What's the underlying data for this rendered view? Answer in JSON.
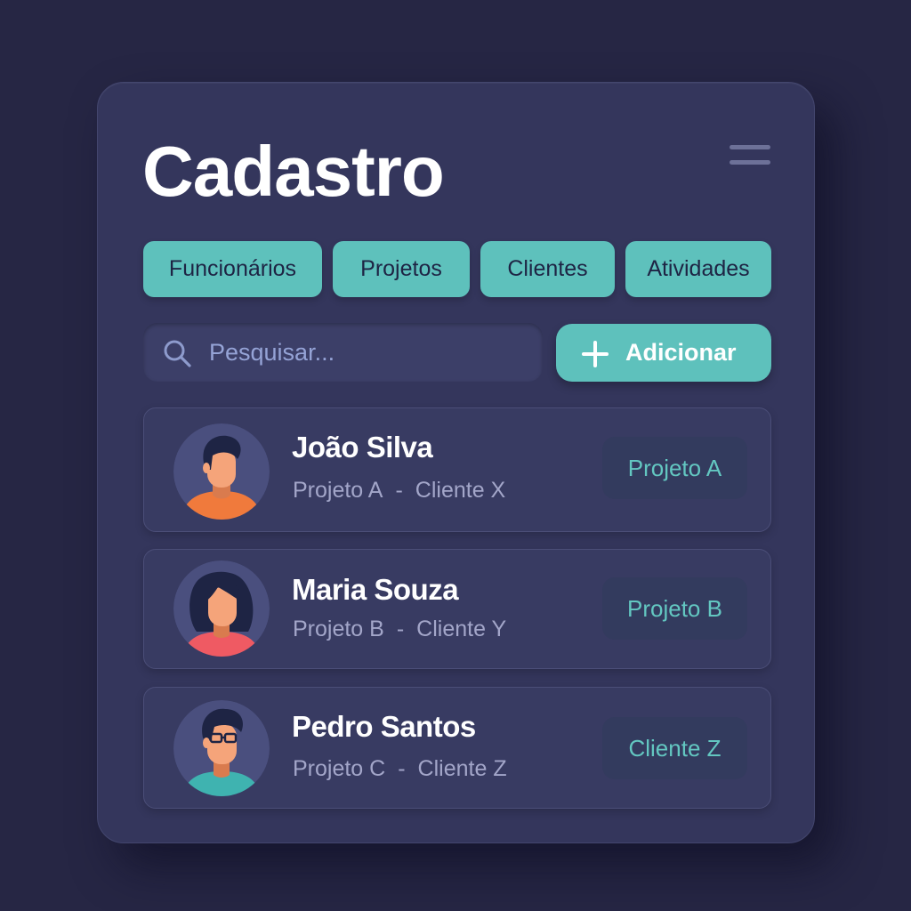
{
  "header": {
    "title": "Cadastro",
    "menu_icon": "hamburger-menu-icon"
  },
  "tabs": [
    {
      "label": "Funcionários"
    },
    {
      "label": "Projetos"
    },
    {
      "label": "Clientes"
    },
    {
      "label": "Atividades"
    }
  ],
  "search": {
    "placeholder": "Pesquisar...",
    "value": "",
    "icon": "search-icon"
  },
  "add_button": {
    "label": "Adicionar",
    "icon": "plus-icon"
  },
  "people": [
    {
      "name": "João Silva",
      "project": "Projeto A",
      "separator": "-",
      "client": "Cliente X",
      "badge": "Projeto A",
      "shirt_color": "#f07a3c"
    },
    {
      "name": "Maria Souza",
      "project": "Projeto B",
      "separator": "-",
      "client": "Cliente Y",
      "badge": "Projeto B",
      "shirt_color": "#ef5a63"
    },
    {
      "name": "Pedro Santos",
      "project": "Projeto C",
      "separator": "-",
      "client": "Cliente Z",
      "badge": "Cliente Z",
      "shirt_color": "#3fb3b0"
    }
  ],
  "colors": {
    "accent": "#5ec1bc",
    "background": "#262644",
    "card": "#34365c"
  }
}
